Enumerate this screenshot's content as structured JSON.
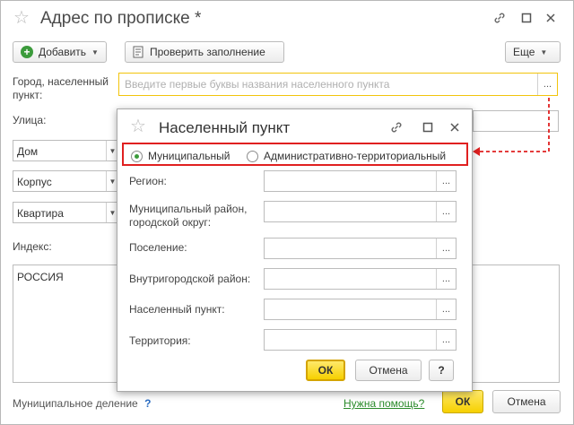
{
  "window": {
    "title": "Адрес по прописке *"
  },
  "toolbar": {
    "add_label": "Добавить",
    "check_label": "Проверить заполнение",
    "more_label": "Еще"
  },
  "form": {
    "city_label_line1": "Город, населенный",
    "city_label_line2": "пункт:",
    "city_placeholder": "Введите первые буквы названия населенного пункта",
    "street_label": "Улица:",
    "combos": [
      {
        "value": "Дом"
      },
      {
        "value": "Корпус"
      },
      {
        "value": "Квартира"
      }
    ],
    "index_label": "Индекс:",
    "address_text": "РОССИЯ",
    "municipal_label": "Муниципальное деление",
    "municipal_help": "?",
    "help_link": "Нужна помощь?",
    "ok_label": "ОК",
    "cancel_label": "Отмена"
  },
  "dialog": {
    "title": "Населенный пункт",
    "radio_municipal": "Муниципальный",
    "radio_admin": "Административно-территориальный",
    "selected": "Муниципальный",
    "fields": {
      "region": "Регион:",
      "district_line1": "Муниципальный район,",
      "district_line2": "городской округ:",
      "settlement": "Поселение:",
      "intracity": "Внутригородской район:",
      "locality": "Населенный пункт:",
      "territory": "Территория:"
    },
    "ok_label": "ОК",
    "cancel_label": "Отмена",
    "help_label": "?"
  },
  "colors": {
    "accent_yellow": "#f6d000",
    "highlight_red": "#e02020",
    "link_green": "#2a8a2a",
    "add_icon_green": "#3c9b3c"
  }
}
